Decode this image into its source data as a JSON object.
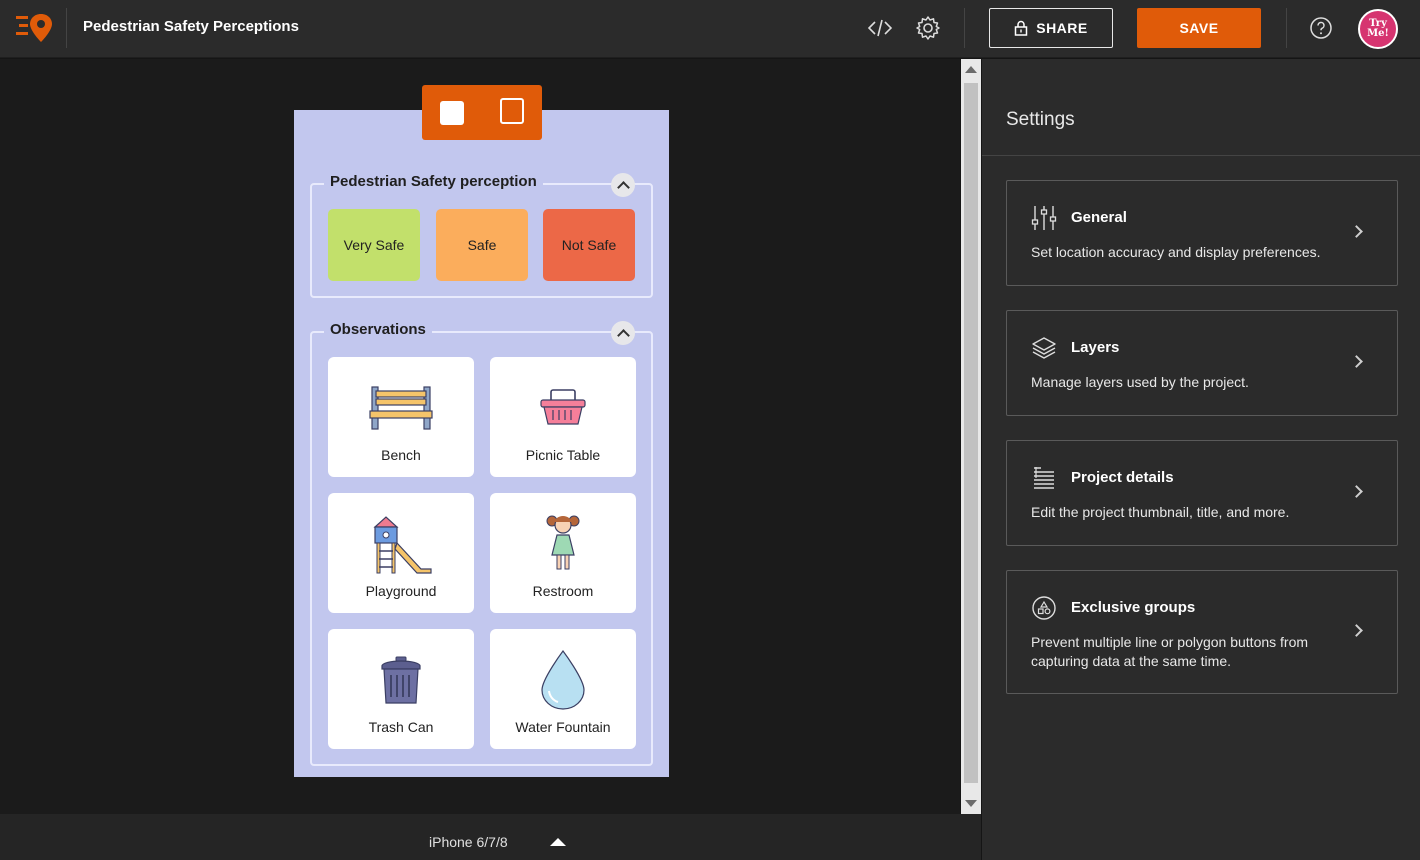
{
  "header": {
    "title": "Pedestrian Safety Perceptions",
    "share_label": "SHARE",
    "save_label": "SAVE",
    "avatar_line1": "Try",
    "avatar_line2": "Me!"
  },
  "preview": {
    "device": "iPhone 6/7/8",
    "groups": {
      "safety": {
        "title": "Pedestrian Safety perception",
        "buttons": [
          {
            "label": "Very Safe",
            "color": "#c2e06b"
          },
          {
            "label": "Safe",
            "color": "#fbad5c"
          },
          {
            "label": "Not Safe",
            "color": "#ec6847"
          }
        ]
      },
      "observations": {
        "title": "Observations",
        "items": [
          {
            "label": "Bench",
            "icon": "bench-icon"
          },
          {
            "label": "Picnic Table",
            "icon": "picnic-basket-icon"
          },
          {
            "label": "Playground",
            "icon": "playground-icon"
          },
          {
            "label": "Restroom",
            "icon": "restroom-icon"
          },
          {
            "label": "Trash Can",
            "icon": "trash-can-icon"
          },
          {
            "label": "Water Fountain",
            "icon": "water-drop-icon"
          }
        ]
      }
    }
  },
  "settings": {
    "title": "Settings",
    "cards": [
      {
        "title": "General",
        "description": "Set location accuracy and display preferences.",
        "icon": "sliders-icon"
      },
      {
        "title": "Layers",
        "description": "Manage layers used by the project.",
        "icon": "layers-icon"
      },
      {
        "title": "Project details",
        "description": "Edit the project thumbnail, title, and more.",
        "icon": "details-list-icon"
      },
      {
        "title": "Exclusive groups",
        "description": "Prevent multiple line or polygon buttons from capturing data at the same time.",
        "icon": "group-shapes-icon"
      }
    ]
  },
  "colors": {
    "accent": "#e05b09",
    "phone_background": "#c2c7ee"
  }
}
